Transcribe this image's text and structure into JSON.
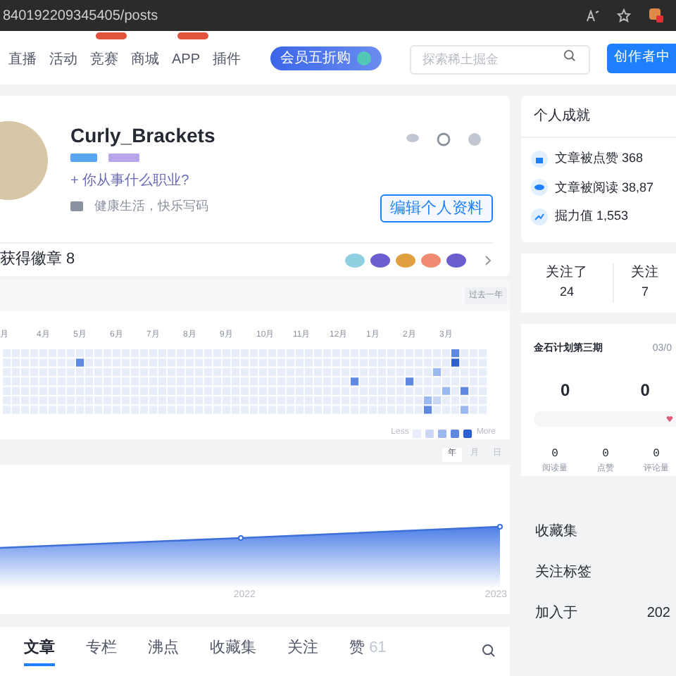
{
  "browser": {
    "url": "840192209345405/posts"
  },
  "nav": {
    "items": [
      {
        "label": "直播",
        "tag": false
      },
      {
        "label": "活动",
        "tag": false
      },
      {
        "label": "竞赛",
        "tag": true
      },
      {
        "label": "商城",
        "tag": false
      },
      {
        "label": "APP",
        "tag": true
      },
      {
        "label": "插件",
        "tag": false
      }
    ],
    "promo": "会员五折购",
    "search": {
      "placeholder": "探索稀土掘金"
    },
    "creator_button": "创作者中"
  },
  "profile": {
    "name": "Curly_Brackets",
    "job_prompt": "+ 你从事什么职业?",
    "bio": "健康生活，快乐写码",
    "edit_button": "编辑个人资料",
    "badges_label": "获得徽章 8"
  },
  "heatmap": {
    "range": "过去一年",
    "months": [
      "月",
      "4月",
      "5月",
      "6月",
      "7月",
      "8月",
      "9月",
      "10月",
      "11月",
      "12月",
      "1月",
      "2月",
      "3月"
    ],
    "legend_less": "Less",
    "legend_more": "More",
    "swatches": [
      {
        "color": "#e8eef9"
      },
      {
        "color": "#c9d7f5"
      },
      {
        "color": "#9cb8f0"
      },
      {
        "color": "#5f88e0"
      },
      {
        "color": "#2d5fd0"
      }
    ]
  },
  "trend": {
    "tabs": [
      {
        "label": "年",
        "selected": true
      },
      {
        "label": "月",
        "selected": false
      },
      {
        "label": "日",
        "selected": false
      }
    ],
    "x_labels": [
      "2022",
      "2023"
    ]
  },
  "content_tabs": [
    {
      "label": "文章",
      "selected": true
    },
    {
      "label": "专栏",
      "selected": false
    },
    {
      "label": "沸点",
      "selected": false
    },
    {
      "label": "收藏集",
      "selected": false
    },
    {
      "label": "关注",
      "selected": false
    },
    {
      "label": "赞",
      "count": "61",
      "selected": false
    }
  ],
  "achievements": {
    "title": "个人成就",
    "items": [
      {
        "kind": "like",
        "text": "文章被点赞 368"
      },
      {
        "kind": "view",
        "text": "文章被阅读 38,87"
      },
      {
        "kind": "power",
        "text": "掘力值 1,553"
      }
    ]
  },
  "follow": [
    {
      "label": "关注了",
      "value": "24"
    },
    {
      "label": "关注",
      "value": "7"
    }
  ],
  "plan": {
    "title": "金石计划第三期",
    "date": "03/0",
    "big": [
      "0",
      "0"
    ],
    "stats": [
      {
        "value": "0",
        "label": "阅读量"
      },
      {
        "value": "0",
        "label": "点赞"
      },
      {
        "value": "0",
        "label": "评论量"
      }
    ]
  },
  "links": [
    {
      "label": "收藏集"
    },
    {
      "label": "关注标签"
    },
    {
      "label": "加入于",
      "value": "202"
    }
  ]
}
